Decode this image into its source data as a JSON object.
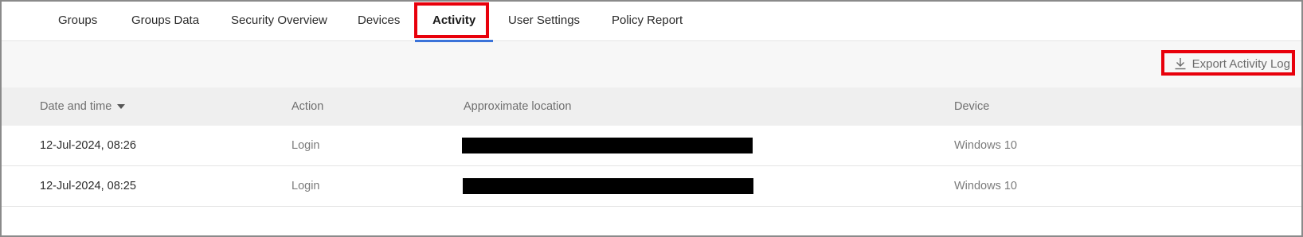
{
  "tabs": [
    {
      "label": "Groups"
    },
    {
      "label": "Groups Data"
    },
    {
      "label": "Security Overview"
    },
    {
      "label": "Devices"
    },
    {
      "label": "Activity",
      "active": true
    },
    {
      "label": "User Settings"
    },
    {
      "label": "Policy Report"
    }
  ],
  "toolbar": {
    "export_label": "Export Activity Log",
    "export_icon": "download-icon"
  },
  "table": {
    "columns": [
      "Date and time",
      "Action",
      "Approximate location",
      "Device"
    ],
    "sort_column": "Date and time",
    "sort_direction": "descending",
    "rows": [
      {
        "date": "12-Jul-2024, 08:26",
        "action": "Login",
        "location": "",
        "device": "Windows 10"
      },
      {
        "date": "12-Jul-2024, 08:25",
        "action": "Login",
        "location": "",
        "device": "Windows 10"
      }
    ]
  },
  "colors": {
    "highlight": "#e8000b",
    "active_tab_underline": "#3b73d9",
    "header_bg": "#efefef",
    "toolbar_bg": "#f7f7f7"
  }
}
